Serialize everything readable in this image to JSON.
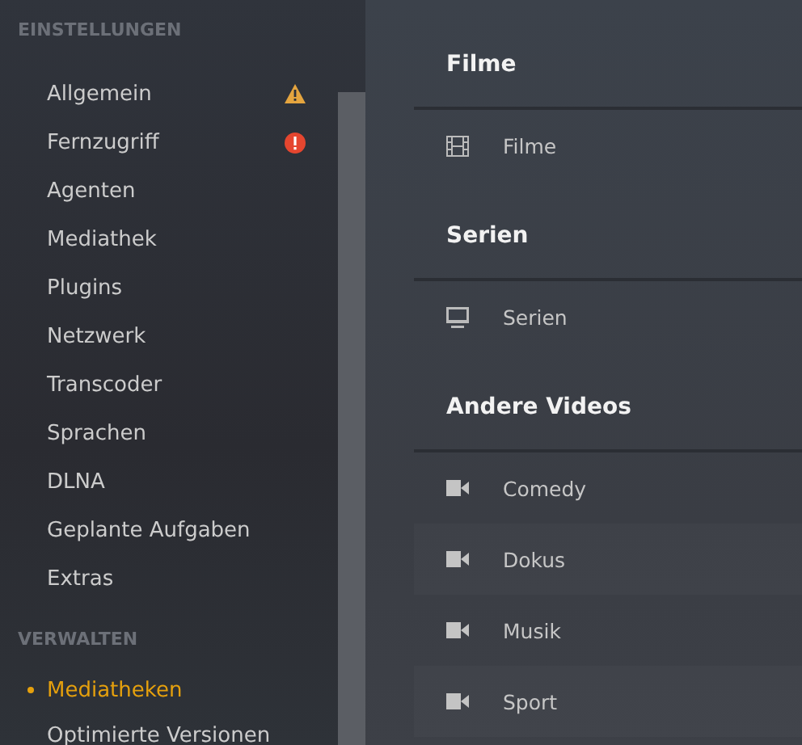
{
  "sidebar": {
    "sections": [
      {
        "title": "EINSTELLUNGEN",
        "items": [
          {
            "label": "Allgemein",
            "selected": false,
            "kind": "warning"
          },
          {
            "label": "Fernzugriff",
            "selected": false,
            "kind": "error"
          },
          {
            "label": "Agenten",
            "selected": false
          },
          {
            "label": "Mediathek",
            "selected": false
          },
          {
            "label": "Plugins",
            "selected": false
          },
          {
            "label": "Netzwerk",
            "selected": false
          },
          {
            "label": "Transcoder",
            "selected": false
          },
          {
            "label": "Sprachen",
            "selected": false
          },
          {
            "label": "DLNA",
            "selected": false
          },
          {
            "label": "Geplante Aufgaben",
            "selected": false
          },
          {
            "label": "Extras",
            "selected": false
          }
        ]
      },
      {
        "title": "VERWALTEN",
        "items": [
          {
            "label": "Mediatheken",
            "selected": true
          },
          {
            "label": "Optimierte Versionen",
            "selected": false
          }
        ]
      }
    ]
  },
  "libraries": [
    {
      "title": "Filme",
      "items": [
        {
          "label": "Filme",
          "kind": "movie"
        }
      ]
    },
    {
      "title": "Serien",
      "items": [
        {
          "label": "Serien",
          "kind": "tv"
        }
      ]
    },
    {
      "title": "Andere Videos",
      "items": [
        {
          "label": "Comedy",
          "kind": "video"
        },
        {
          "label": "Dokus",
          "kind": "video"
        },
        {
          "label": "Musik",
          "kind": "video"
        },
        {
          "label": "Sport",
          "kind": "video"
        }
      ]
    }
  ]
}
